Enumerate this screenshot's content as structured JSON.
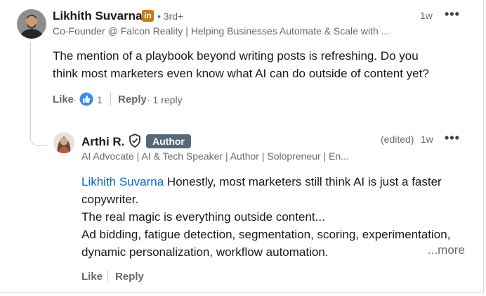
{
  "comment": {
    "author_name": "Likhith Suvarna",
    "linkedin_badge": "in",
    "degree": "• 3rd+",
    "headline": "Co-Founder @ Falcon Reality | Helping Businesses Automate & Scale with ...",
    "time": "1w",
    "menu": "•••",
    "text": "The mention of a playbook beyond writing posts is refreshing. Do you think most marketers even know what AI can do outside of content yet?",
    "actions": {
      "like": "Like",
      "dot": "·",
      "reaction_count": "1",
      "reply": "Reply",
      "reply_count": "· 1 reply"
    }
  },
  "reply": {
    "author_name": "Arthi R.",
    "author_badge": "Author",
    "headline": "AI Advocate | AI & Tech Speaker | Author | Solopreneur | En...",
    "edited": "(edited)",
    "time": "1w",
    "menu": "•••",
    "mention": "Likhith Suvarna",
    "line1_rest": " Honestly, most marketers still think AI is just a faster",
    "line2": "copywriter.",
    "line3": "The real magic is everything outside content...",
    "line4": "Ad bidding, fatigue detection, segmentation, scoring, experimentation,",
    "line5": "dynamic personalization, workflow automation.",
    "more": "...more",
    "actions": {
      "like": "Like",
      "reply": "Reply"
    }
  },
  "colors": {
    "link": "#0a66c2",
    "author_badge_bg": "#56687a",
    "like_reaction": "#378fe9",
    "linkedin_badge_bg": "#c37d16"
  }
}
